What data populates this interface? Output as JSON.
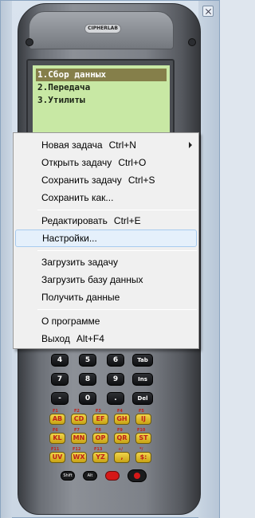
{
  "device": {
    "logo": "CIPHERLAB",
    "screen_lines": [
      "1.Сбор данных",
      "2.Передача",
      "3.Утилиты"
    ]
  },
  "menu": {
    "items": [
      {
        "label": "Новая задача",
        "shortcut": "Ctrl+N",
        "has_submenu": true
      },
      {
        "label": "Открыть задачу",
        "shortcut": "Ctrl+O"
      },
      {
        "label": "Сохранить задачу",
        "shortcut": "Ctrl+S"
      },
      {
        "label": "Сохранить как...",
        "shortcut": ""
      },
      {
        "label": "Редактировать",
        "shortcut": "Ctrl+E"
      },
      {
        "label": "Настройки...",
        "shortcut": "",
        "highlighted": true
      },
      {
        "label": "Загрузить задачу",
        "shortcut": ""
      },
      {
        "label": "Загрузить базу данных",
        "shortcut": ""
      },
      {
        "label": "Получить данные",
        "shortcut": ""
      },
      {
        "label": "О программе",
        "shortcut": ""
      },
      {
        "label": "Выход",
        "shortcut": "Alt+F4"
      }
    ]
  },
  "keypad": {
    "digits_row1": [
      "4",
      "5",
      "6",
      "Tab"
    ],
    "digits_row2": [
      "7",
      "8",
      "9",
      "Ins"
    ],
    "digits_row3": [
      "-",
      "0",
      ".",
      "Del"
    ],
    "f_row1_labels": [
      "F1",
      "F2",
      "F3",
      "F4",
      "F5"
    ],
    "f_row1_keys": [
      "AB",
      "CD",
      "EF",
      "GH",
      "IJ"
    ],
    "f_row2_labels": [
      "F6",
      "F7",
      "F8",
      "F9",
      "F10"
    ],
    "f_row2_keys": [
      "KL",
      "MN",
      "OP",
      "QR",
      "ST"
    ],
    "f_row3_labels": [
      "F11",
      "F12",
      "F13",
      "+/",
      "*/"
    ],
    "f_row3_keys": [
      "UV",
      "WX",
      "YZ",
      ",",
      "$:"
    ],
    "bottom_keys": [
      "Shift",
      "Alt"
    ]
  },
  "colors": {
    "screen_bg": "#c8e8a4",
    "selected_line": "#857f4a",
    "menu_bg": "#f0f0f0",
    "menu_highlight": "#e5f0fb",
    "fkey": "#e0c030"
  }
}
